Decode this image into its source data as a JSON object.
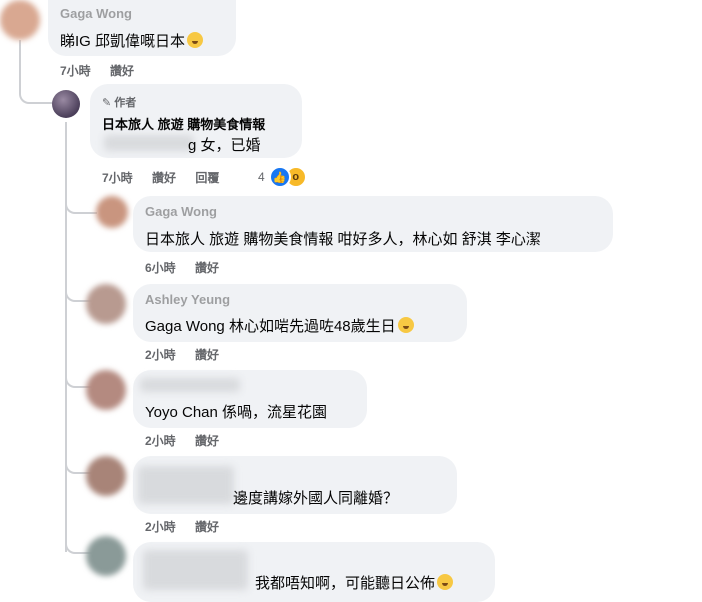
{
  "comments": [
    {
      "name": "Gaga Wong",
      "text": "睇IG 邱凱偉嘅日本",
      "time": "7小時",
      "actions": [
        "讚好"
      ]
    },
    {
      "badge": "作者",
      "name": "日本旅人 旅遊 購物美食情報",
      "text": "g 女，已婚",
      "time": "7小時",
      "actions": [
        "讚好",
        "回覆"
      ],
      "reactions": "4"
    },
    {
      "name": "Gaga Wong",
      "text": "日本旅人 旅遊 購物美食情報 咁好多人，林心如 舒淇 李心潔",
      "time": "6小時",
      "actions": [
        "讚好"
      ]
    },
    {
      "name": "Ashley Yeung",
      "text": "Gaga Wong 林心如啱先過咗48歲生日",
      "time": "2小時",
      "actions": [
        "讚好"
      ]
    },
    {
      "text": "Yoyo Chan 係喎，流星花園",
      "time": "2小時",
      "actions": [
        "讚好"
      ]
    },
    {
      "text": "邊度講嫁外國人同離婚？",
      "time": "2小時",
      "actions": [
        "讚好"
      ]
    },
    {
      "text": "我都唔知啊，可能聽日公佈"
    }
  ]
}
